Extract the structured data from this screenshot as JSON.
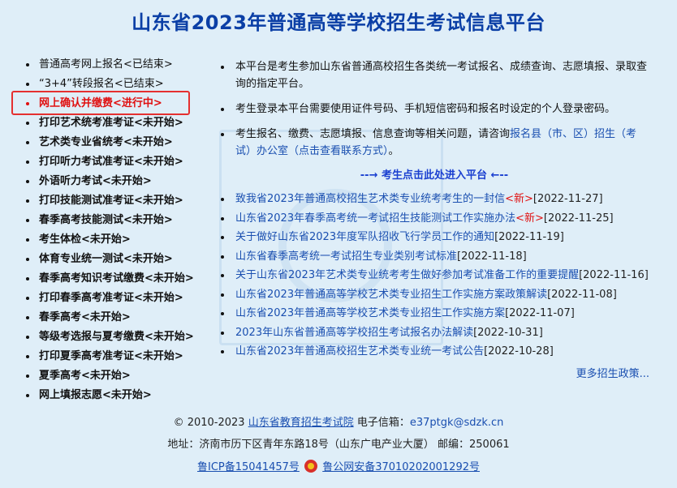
{
  "title": "山东省2023年普通高等学校招生考试信息平台",
  "sidebar": {
    "items": [
      {
        "label": "普通高考网上报名<已结束>",
        "style": "normal"
      },
      {
        "label": "“3+4”转段报名<已结束>",
        "style": "normal"
      },
      {
        "label": "网上确认并缴费<进行中>",
        "style": "active"
      },
      {
        "label": "打印艺术统考准考证<未开始>",
        "style": "bold"
      },
      {
        "label": "艺术类专业省统考<未开始>",
        "style": "bold"
      },
      {
        "label": "打印听力考试准考证<未开始>",
        "style": "bold"
      },
      {
        "label": "外语听力考试<未开始>",
        "style": "bold"
      },
      {
        "label": "打印技能测试准考证<未开始>",
        "style": "bold"
      },
      {
        "label": "春季高考技能测试<未开始>",
        "style": "bold"
      },
      {
        "label": "考生体检<未开始>",
        "style": "bold"
      },
      {
        "label": "体育专业统一测试<未开始>",
        "style": "bold"
      },
      {
        "label": "春季高考知识考试缴费<未开始>",
        "style": "bold"
      },
      {
        "label": "打印春季高考准考证<未开始>",
        "style": "bold"
      },
      {
        "label": "春季高考<未开始>",
        "style": "bold"
      },
      {
        "label": "等级考选报与夏考缴费<未开始>",
        "style": "bold"
      },
      {
        "label": "打印夏季高考准考证<未开始>",
        "style": "bold"
      },
      {
        "label": "夏季高考<未开始>",
        "style": "bold"
      },
      {
        "label": "网上填报志愿<未开始>",
        "style": "bold"
      }
    ]
  },
  "notices": {
    "n1": "本平台是考生参加山东省普通高校招生各类统一考试报名、成绩查询、志愿填报、录取查询的指定平台。",
    "n2": "考生登录本平台需要使用证件号码、手机短信密码和报名时设定的个人登录密码。",
    "n3_text": "考生报名、缴费、志愿填报、信息查询等相关问题，请咨询",
    "n3_link": "报名县（市、区）招生（考试）办公室",
    "n3_link2": "（点击查看联系方式）",
    "n3_end": "。"
  },
  "enter_link": "--→ 考生点击此处进入平台 ←--",
  "news": [
    {
      "title": "致我省2023年普通高校招生艺术类专业统考考生的一封信",
      "new": "<新>",
      "date": "[2022-11-27]"
    },
    {
      "title": "山东省2023年春季高考统一考试招生技能测试工作实施办法",
      "new": "<新>",
      "date": "[2022-11-25]"
    },
    {
      "title": "关于做好山东省2023年度军队招收飞行学员工作的通知",
      "new": "",
      "date": "[2022-11-19]"
    },
    {
      "title": "山东省春季高考统一考试招生专业类别考试标准",
      "new": "",
      "date": "[2022-11-18]"
    },
    {
      "title": "关于山东省2023年艺术类专业统考考生做好参加考试准备工作的重要提醒",
      "new": "",
      "date": "[2022-11-16]"
    },
    {
      "title": "山东省2023年普通高等学校艺术类专业招生工作实施方案政策解读",
      "new": "",
      "date": "[2022-11-08]"
    },
    {
      "title": "山东省2023年普通高等学校艺术类专业招生工作实施方案",
      "new": "",
      "date": "[2022-11-07]"
    },
    {
      "title": "2023年山东省普通高等学校招生考试报名办法解读",
      "new": "",
      "date": "[2022-10-31]"
    },
    {
      "title": "山东省2023年普通高校招生艺术类专业统一考试公告",
      "new": "",
      "date": "[2022-10-28]"
    }
  ],
  "more": "更多招生政策...",
  "footer": {
    "copyright": "© 2010-2023 ",
    "org": "山东省教育招生考试院",
    "email_label": " 电子信箱：",
    "email": "e37ptgk@sdzk.cn",
    "address": "地址：济南市历下区青年东路18号（山东广电产业大厦） 邮编：250061",
    "icp": "鲁ICP备15041457号",
    "police": "鲁公网安备37010202001292号"
  }
}
